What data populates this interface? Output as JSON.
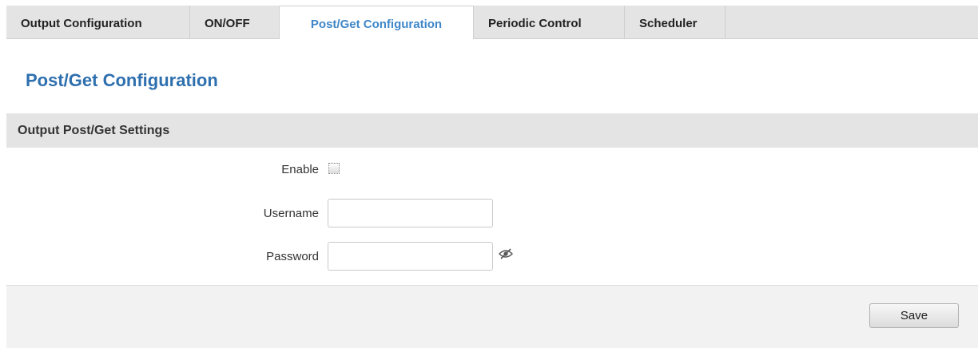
{
  "tabs": [
    {
      "label": "Output Configuration"
    },
    {
      "label": "ON/OFF"
    },
    {
      "label": "Post/Get Configuration",
      "active": true
    },
    {
      "label": "Periodic Control"
    },
    {
      "label": "Scheduler"
    }
  ],
  "page": {
    "title": "Post/Get Configuration"
  },
  "section": {
    "title": "Output Post/Get Settings",
    "enable": {
      "label": "Enable",
      "checked": false
    },
    "username": {
      "label": "Username",
      "value": ""
    },
    "password": {
      "label": "Password",
      "value": "",
      "toggle_icon": "eye-slash-icon"
    }
  },
  "footer": {
    "save_label": "Save"
  },
  "colors": {
    "accent": "#3f87c9",
    "title": "#2e6fae",
    "header_bg": "#e4e4e4",
    "footer_bg": "#f2f2f2"
  }
}
